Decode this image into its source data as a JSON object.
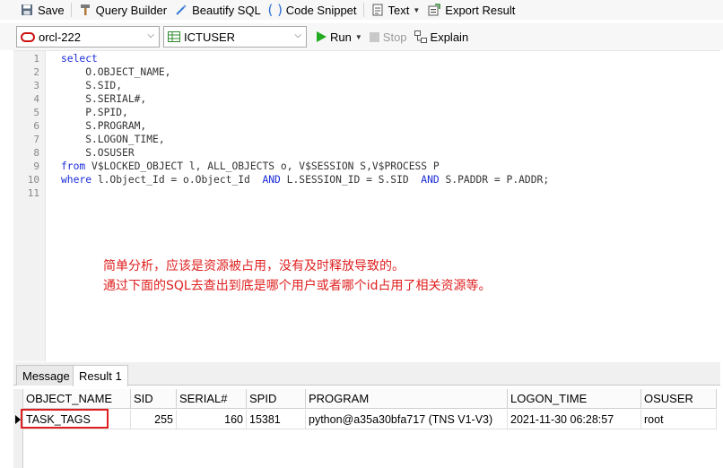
{
  "toolbar": {
    "save": "Save",
    "query_builder": "Query Builder",
    "beautify_sql": "Beautify SQL",
    "code_snippet": "Code Snippet",
    "text": "Text",
    "export_result": "Export Result"
  },
  "connection": {
    "value": "orcl-222"
  },
  "schema": {
    "value": "ICTUSER"
  },
  "run_bar": {
    "run": "Run",
    "stop": "Stop",
    "explain": "Explain"
  },
  "editor": {
    "line_numbers": [
      "1",
      "2",
      "3",
      "4",
      "5",
      "6",
      "7",
      "8",
      "9",
      "10",
      "11"
    ],
    "lines": [
      {
        "parts": [
          {
            "t": "select",
            "kw": true
          }
        ]
      },
      {
        "parts": [
          {
            "t": "    O.OBJECT_NAME,",
            "kw": false
          }
        ]
      },
      {
        "parts": [
          {
            "t": "    S.SID,",
            "kw": false
          }
        ]
      },
      {
        "parts": [
          {
            "t": "    S.SERIAL#,",
            "kw": false
          }
        ]
      },
      {
        "parts": [
          {
            "t": "    P.SPID,",
            "kw": false
          }
        ]
      },
      {
        "parts": [
          {
            "t": "    S.PROGRAM,",
            "kw": false
          }
        ]
      },
      {
        "parts": [
          {
            "t": "    S.LOGON_TIME,",
            "kw": false
          }
        ]
      },
      {
        "parts": [
          {
            "t": "    S.OSUSER",
            "kw": false
          }
        ]
      },
      {
        "parts": [
          {
            "t": "from",
            "kw": true
          },
          {
            "t": " V$LOCKED_OBJECT l, ALL_OBJECTS o, V$SESSION S,V$PROCESS P",
            "kw": false
          }
        ]
      },
      {
        "parts": [
          {
            "t": "where",
            "kw": true
          },
          {
            "t": " l.Object_Id = o.Object_Id  ",
            "kw": false
          },
          {
            "t": "AND",
            "kw": true
          },
          {
            "t": " L.SESSION_ID = S.SID  ",
            "kw": false
          },
          {
            "t": "AND",
            "kw": true
          },
          {
            "t": " S.PADDR = P.ADDR;",
            "kw": false
          }
        ]
      },
      {
        "parts": []
      }
    ],
    "note_line1": "简单分析，应该是资源被占用，没有及时释放导致的。",
    "note_line2": "通过下面的SQL去查出到底是哪个用户或者哪个id占用了相关资源等。"
  },
  "tabs": {
    "message": "Message",
    "result1": "Result 1"
  },
  "result": {
    "columns": [
      "OBJECT_NAME",
      "SID",
      "SERIAL#",
      "SPID",
      "PROGRAM",
      "LOGON_TIME",
      "OSUSER"
    ],
    "rows": [
      [
        "TASK_TAGS",
        "255",
        "160",
        "15381",
        "python@a35a30bfa717 (TNS V1-V3)",
        "2021-11-30 06:28:57",
        "root"
      ]
    ]
  },
  "colors": {
    "keyword": "#1a2bd9",
    "annotation_red": "#e02020",
    "run_green": "#22aa22",
    "connection_red": "#cc1111"
  }
}
